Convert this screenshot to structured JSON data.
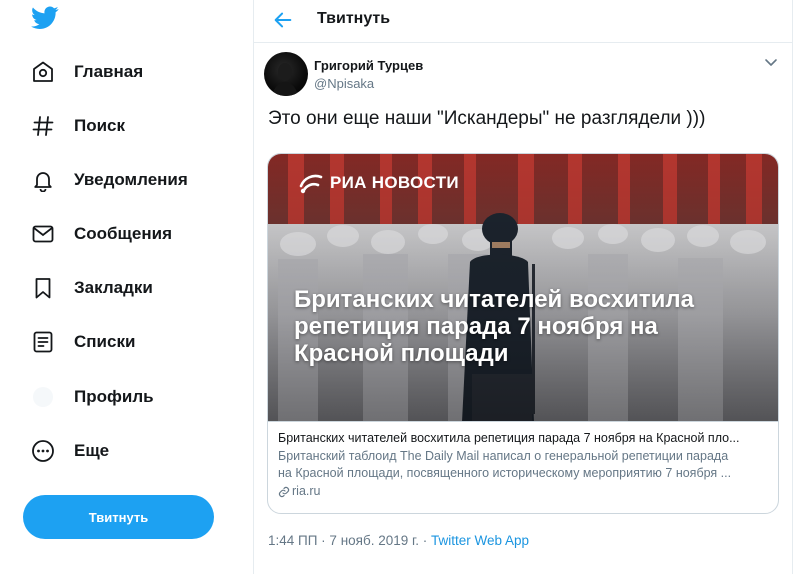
{
  "colors": {
    "accent": "#1da1f2",
    "text": "#14171a",
    "secondary": "#657786",
    "border": "#e6ecf0"
  },
  "sidebar": {
    "logo": "twitter-bird-icon",
    "items": [
      {
        "label": "Главная",
        "icon": "home-icon"
      },
      {
        "label": "Поиск",
        "icon": "hashtag-icon"
      },
      {
        "label": "Уведомления",
        "icon": "bell-icon"
      },
      {
        "label": "Сообщения",
        "icon": "envelope-icon"
      },
      {
        "label": "Закладки",
        "icon": "bookmark-icon"
      },
      {
        "label": "Списки",
        "icon": "list-icon"
      },
      {
        "label": "Профиль",
        "icon": "profile-icon"
      },
      {
        "label": "Еще",
        "icon": "more-icon"
      }
    ],
    "tweet_button": "Твитнуть"
  },
  "header": {
    "title": "Твитнуть"
  },
  "tweet": {
    "author_name": "Григорий Турцев",
    "author_handle": "@Npisaka",
    "text": "Это они еще наши \"Искандеры\" не разглядели )))",
    "card": {
      "brand": "РИА НОВОСТИ",
      "headline": "Британских читателей восхитила репетиция парада 7 ноября на Красной площади",
      "title": "Британских читателей восхитила репетиция парада 7 ноября на Красной пло...",
      "description_lines": [
        "Британский таблоид The Daily Mail написал о генеральной репетиции парада",
        "на Красной площади, посвященного историческому мероприятию 7 ноября ..."
      ],
      "domain": "ria.ru"
    },
    "timestamp": "1:44 ПП · 7 нояб. 2019 г. · ",
    "source_app": "Twitter Web App"
  }
}
